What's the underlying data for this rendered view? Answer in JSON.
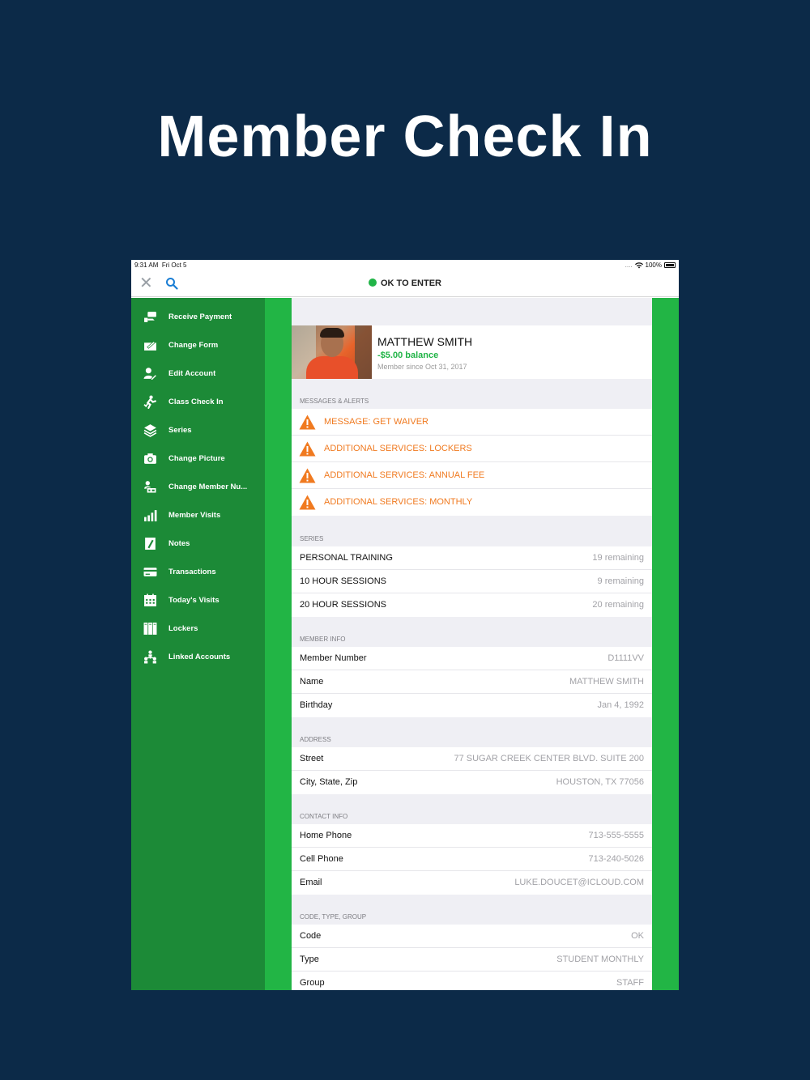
{
  "hero_title": "Member Check In",
  "status_bar": {
    "time": "9:31 AM",
    "date": "Fri Oct 5",
    "signal": "....",
    "battery": "100%"
  },
  "navbar": {
    "close_icon": "close-icon",
    "search_icon": "search-icon",
    "status_label": "OK TO ENTER",
    "status_color": "#21b447"
  },
  "sidebar": {
    "items": [
      {
        "label": "Receive Payment",
        "icon": "payment-icon"
      },
      {
        "label": "Change Form",
        "icon": "form-icon"
      },
      {
        "label": "Edit Account",
        "icon": "edit-account-icon"
      },
      {
        "label": "Class Check In",
        "icon": "class-checkin-icon"
      },
      {
        "label": "Series",
        "icon": "series-icon"
      },
      {
        "label": "Change Picture",
        "icon": "camera-icon"
      },
      {
        "label": "Change Member Nu...",
        "icon": "member-number-icon"
      },
      {
        "label": "Member Visits",
        "icon": "bar-chart-icon"
      },
      {
        "label": "Notes",
        "icon": "notes-icon"
      },
      {
        "label": "Transactions",
        "icon": "card-icon"
      },
      {
        "label": "Today's Visits",
        "icon": "calendar-icon"
      },
      {
        "label": "Lockers",
        "icon": "lockers-icon"
      },
      {
        "label": "Linked Accounts",
        "icon": "linked-accounts-icon"
      }
    ]
  },
  "profile": {
    "name": "MATTHEW SMITH",
    "balance": "-$5.00 balance",
    "since": "Member since Oct 31, 2017"
  },
  "alerts": {
    "header": "MESSAGES & ALERTS",
    "items": [
      "MESSAGE: GET WAIVER",
      "ADDITIONAL SERVICES: LOCKERS",
      "ADDITIONAL SERVICES: ANNUAL FEE",
      "ADDITIONAL SERVICES: MONTHLY"
    ],
    "color": "#f07a20"
  },
  "series": {
    "header": "SERIES",
    "rows": [
      {
        "label": "PERSONAL TRAINING",
        "value": "19 remaining"
      },
      {
        "label": "10 HOUR SESSIONS",
        "value": "9 remaining"
      },
      {
        "label": "20 HOUR SESSIONS",
        "value": "20 remaining"
      }
    ]
  },
  "member_info": {
    "header": "MEMBER INFO",
    "rows": [
      {
        "label": "Member Number",
        "value": "D1111VV"
      },
      {
        "label": "Name",
        "value": "MATTHEW SMITH"
      },
      {
        "label": "Birthday",
        "value": "Jan 4, 1992"
      }
    ]
  },
  "address": {
    "header": "ADDRESS",
    "rows": [
      {
        "label": "Street",
        "value": "77 SUGAR CREEK CENTER BLVD. SUITE 200"
      },
      {
        "label": "City, State, Zip",
        "value": "HOUSTON, TX 77056"
      }
    ]
  },
  "contact": {
    "header": "CONTACT INFO",
    "rows": [
      {
        "label": "Home Phone",
        "value": "713-555-5555"
      },
      {
        "label": "Cell Phone",
        "value": "713-240-5026"
      },
      {
        "label": "Email",
        "value": "LUKE.DOUCET@ICLOUD.COM"
      }
    ]
  },
  "code_type_group": {
    "header": "CODE, TYPE, GROUP",
    "rows": [
      {
        "label": "Code",
        "value": "OK"
      },
      {
        "label": "Type",
        "value": "STUDENT MONTHLY"
      },
      {
        "label": "Group",
        "value": "STAFF"
      }
    ]
  }
}
